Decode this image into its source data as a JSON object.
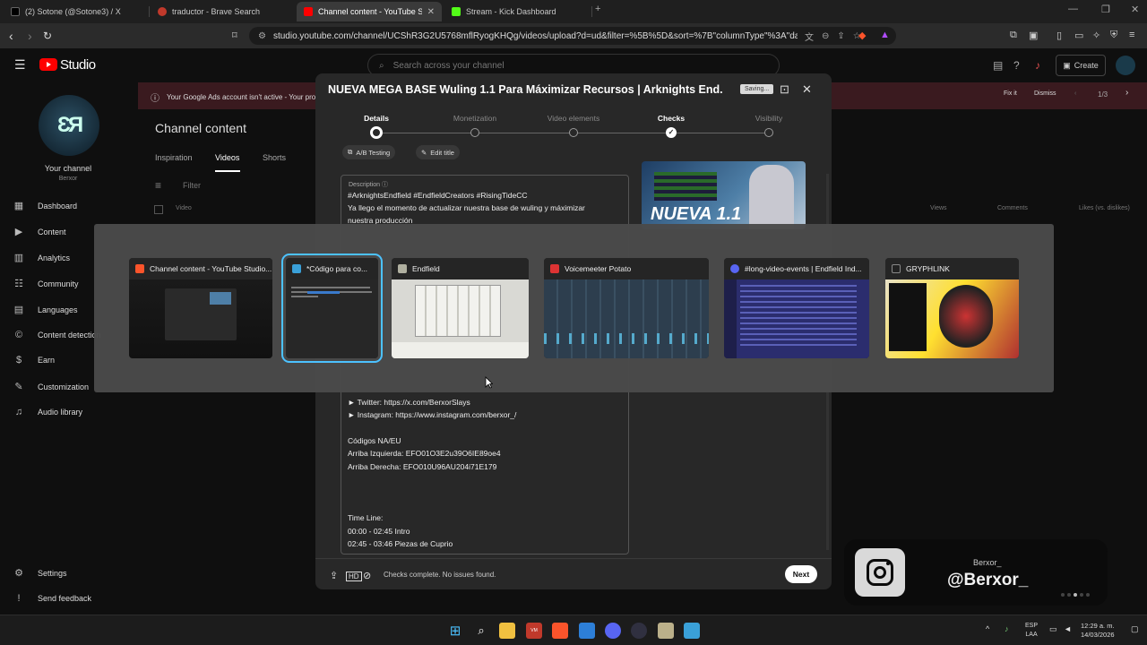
{
  "browser": {
    "tabs": [
      {
        "title": "(2) Sotone (@Sotone3) / X",
        "color": "#000000"
      },
      {
        "title": "traductor - Brave Search",
        "color": "#c0392b"
      },
      {
        "title": "Channel content - YouTube Studio",
        "color": "#ff0000"
      },
      {
        "title": "Stream - Kick Dashboard",
        "color": "#53fc18"
      }
    ],
    "url": "studio.youtube.com/channel/UCShR3G2U5768mflRyogKHQg/videos/upload?d=ud&filter=%5B%5D&sort=%7B\"columnType\"%3A\"date\"%..."
  },
  "studio": {
    "logo_text": "Studio",
    "search_placeholder": "Search across your channel",
    "create_label": "Create",
    "channel": {
      "initials": "ƐЯ",
      "your_channel": "Your channel",
      "name": "Berxor"
    },
    "sidebar": [
      {
        "label": "Dashboard",
        "icon": "▦"
      },
      {
        "label": "Content",
        "icon": "▶"
      },
      {
        "label": "Analytics",
        "icon": "▥"
      },
      {
        "label": "Community",
        "icon": "☷"
      },
      {
        "label": "Languages",
        "icon": "▤"
      },
      {
        "label": "Content detection",
        "icon": "©"
      },
      {
        "label": "Earn",
        "icon": "$"
      },
      {
        "label": "Customization",
        "icon": "✎"
      },
      {
        "label": "Audio library",
        "icon": "♫"
      }
    ],
    "sidebar_bottom": [
      {
        "label": "Settings",
        "icon": "⚙"
      },
      {
        "label": "Send feedback",
        "icon": "!"
      }
    ],
    "banner": {
      "text": "Your Google Ads account isn't active - Your proc",
      "fix": "Fix it",
      "dismiss": "Dismiss",
      "pager": "1/3"
    },
    "page_title": "Channel content",
    "tabs": [
      "Inspiration",
      "Videos",
      "Shorts"
    ],
    "filter_placeholder": "Filter",
    "columns": [
      "Video",
      "Views",
      "Comments",
      "Likes (vs. dislikes)"
    ]
  },
  "modal": {
    "title": "NUEVA MEGA BASE Wuling 1.1 Para Máximizar Recursos | Arknights End...",
    "saving": "Saving...",
    "steps": [
      "Details",
      "Monetization",
      "Video elements",
      "Checks",
      "Visibility"
    ],
    "ab_testing": "A/B Testing",
    "edit_title": "Edit title",
    "description_label": "Description",
    "description_lines": [
      "#ArknightsEndfield #EndfieldCreators #RisingTideCC",
      "Ya llego el momento de actualizar nuestra base de wuling y máximizar",
      "nuestra producción"
    ],
    "description_lower": [
      "► Twitter: https://x.com/BerxorSlays",
      "► Instagram: https://www.instagram.com/berxor_/",
      "",
      "Códigos NA/EU",
      "Arriba Izquierda: EFO01O3E2u39O6IE89oe4",
      "Arriba Derecha: EFO010U96AU204i71E179",
      "",
      "",
      "",
      "Time Line:",
      "00:00 - 02:45 Intro",
      "02:45 - 03:46 Piezas de Cuprio"
    ],
    "thumbnail_text": "NUEVA 1.1",
    "checks_status": "Checks complete. No issues found.",
    "next_label": "Next"
  },
  "switcher": {
    "windows": [
      {
        "title": "Channel content - YouTube Studio...",
        "icon_color": "#fb542b"
      },
      {
        "title": "*Código para co...",
        "icon_color": "#3aa0d8"
      },
      {
        "title": "Endfield",
        "icon_color": "#b0b0a0"
      },
      {
        "title": "Voicemeeter Potato",
        "icon_color": "#d33"
      },
      {
        "title": "#long-video-events | Endfield Ind...",
        "icon_color": "#5865f2"
      },
      {
        "title": "GRYPHLINK",
        "icon_color": "#222"
      }
    ]
  },
  "overlay": {
    "username": "Berxor_",
    "handle": "@Berxor_"
  },
  "taskbar": {
    "lang_top": "ESP",
    "lang_bottom": "LAA",
    "time": "12:29 a. m.",
    "date": "14/03/2026"
  }
}
